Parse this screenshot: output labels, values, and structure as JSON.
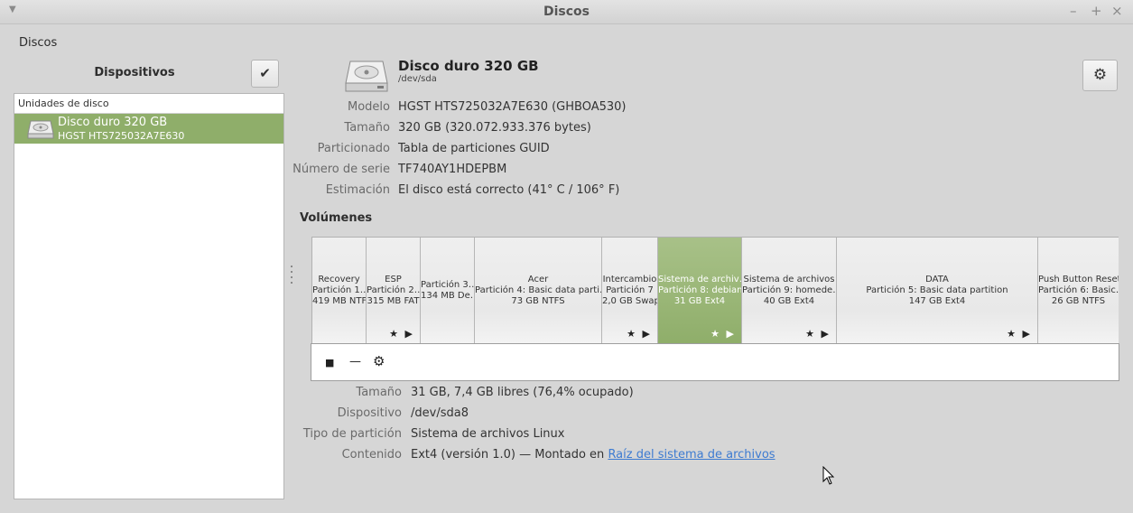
{
  "window": {
    "title": "Discos",
    "minimize": "–",
    "maximize": "+",
    "close": "×",
    "menu_arrow": "▼"
  },
  "menubar": {
    "menu": "Discos"
  },
  "sidebar": {
    "title": "Dispositivos",
    "check_icon": "✔",
    "section": "Unidades de disco",
    "devices": [
      {
        "name": "Disco duro 320 GB",
        "model": "HGST HTS725032A7E630",
        "icon": "harddisk-icon"
      }
    ]
  },
  "disk": {
    "title": "Disco duro 320 GB",
    "path": "/dev/sda",
    "gear_icon": "⚙",
    "props": [
      {
        "label": "Modelo",
        "value": "HGST HTS725032A7E630 (GHBOA530)"
      },
      {
        "label": "Tamaño",
        "value": "320 GB (320.072.933.376 bytes)"
      },
      {
        "label": "Particionado",
        "value": "Tabla de particiones GUID"
      },
      {
        "label": "Número de serie",
        "value": "TF740AY1HDEPBM"
      },
      {
        "label": "Estimación",
        "value": "El disco está correcto (41° C / 106° F)"
      }
    ]
  },
  "volumes": {
    "title": "Volúmenes",
    "partitions": [
      {
        "l1": "Recovery",
        "l2": "Partición 1…",
        "l3": "419 MB NTFS",
        "marks": ""
      },
      {
        "l1": "ESP",
        "l2": "Partición 2…",
        "l3": "315 MB FAT",
        "marks": "★ ▶"
      },
      {
        "l1": "Partición 3…",
        "l2": "134 MB De…",
        "l3": "",
        "marks": ""
      },
      {
        "l1": "Acer",
        "l2": "Partición 4: Basic data parti…",
        "l3": "73 GB NTFS",
        "marks": ""
      },
      {
        "l1": "Intercambio",
        "l2": "Partición 7",
        "l3": "2,0 GB Swap",
        "marks": "★ ▶"
      },
      {
        "l1": "Sistema de archiv…",
        "l2": "Partición 8: debian",
        "l3": "31 GB Ext4",
        "marks": "★ ▶"
      },
      {
        "l1": "Sistema de archivos",
        "l2": "Partición 9: homede…",
        "l3": "40 GB Ext4",
        "marks": "★ ▶"
      },
      {
        "l1": "DATA",
        "l2": "Partición 5: Basic data partition",
        "l3": "147 GB Ext4",
        "marks": "★ ▶"
      },
      {
        "l1": "Push Button Reset",
        "l2": "Partición 6: Basic…",
        "l3": "26 GB NTFS",
        "marks": ""
      }
    ],
    "tools": {
      "stop": "■",
      "remove": "—",
      "settings": "⚙"
    }
  },
  "selected_volume": {
    "props": [
      {
        "label": "Tamaño",
        "value": "31 GB, 7,4 GB libres (76,4% ocupado)"
      },
      {
        "label": "Dispositivo",
        "value": "/dev/sda8"
      },
      {
        "label": "Tipo de partición",
        "value": "Sistema de archivos Linux"
      }
    ],
    "content_label": "Contenido",
    "content_value": "Ext4 (versión 1.0) — Montado en",
    "content_link": "Raíz del sistema de archivos"
  }
}
